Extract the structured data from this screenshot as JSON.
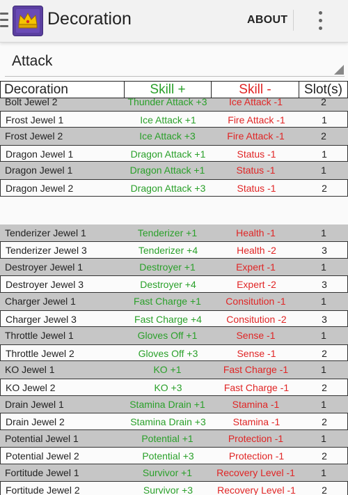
{
  "app": {
    "title": "Decoration",
    "about_label": "ABOUT"
  },
  "spinner": {
    "value": "Attack"
  },
  "table": {
    "headers": {
      "name": "Decoration",
      "plus": "Skill +",
      "minus": "Skill -",
      "slots": "Slot(s)"
    },
    "groups": [
      [
        {
          "name": "Bolt Jewel 2",
          "plus": "Thunder Attack +3",
          "minus": "Ice Attack -1",
          "slots": "2"
        },
        {
          "name": "Frost Jewel 1",
          "plus": "Ice Attack +1",
          "minus": "Fire Attack -1",
          "slots": "1"
        },
        {
          "name": "Frost Jewel 2",
          "plus": "Ice Attack +3",
          "minus": "Fire Attack -1",
          "slots": "2"
        },
        {
          "name": "Dragon Jewel 1",
          "plus": "Dragon Attack +1",
          "minus": "Status -1",
          "slots": "1"
        },
        {
          "name": "Dragon Jewel 1",
          "plus": "Dragon Attack +1",
          "minus": "Status -1",
          "slots": "1"
        },
        {
          "name": "Dragon Jewel 2",
          "plus": "Dragon Attack +3",
          "minus": "Status -1",
          "slots": "2"
        }
      ],
      [
        {
          "name": "Tenderizer Jewel 1",
          "plus": "Tenderizer +1",
          "minus": "Health -1",
          "slots": "1"
        },
        {
          "name": "Tenderizer Jewel 3",
          "plus": "Tenderizer +4",
          "minus": "Health -2",
          "slots": "3"
        },
        {
          "name": "Destroyer Jewel 1",
          "plus": "Destroyer +1",
          "minus": "Expert -1",
          "slots": "1"
        },
        {
          "name": "Destroyer Jewel 3",
          "plus": "Destroyer +4",
          "minus": "Expert -2",
          "slots": "3"
        },
        {
          "name": "Charger Jewel 1",
          "plus": "Fast Charge +1",
          "minus": "Consitution -1",
          "slots": "1"
        },
        {
          "name": "Charger Jewel 3",
          "plus": "Fast Charge +4",
          "minus": "Consitution -2",
          "slots": "3"
        },
        {
          "name": "Throttle Jewel 1",
          "plus": "Gloves Off +1",
          "minus": "Sense -1",
          "slots": "1"
        },
        {
          "name": "Throttle Jewel 2",
          "plus": "Gloves Off +3",
          "minus": "Sense -1",
          "slots": "2"
        },
        {
          "name": "KO Jewel 1",
          "plus": "KO +1",
          "minus": "Fast Charge -1",
          "slots": "1"
        },
        {
          "name": "KO Jewel 2",
          "plus": "KO +3",
          "minus": "Fast Charge -1",
          "slots": "2"
        },
        {
          "name": "Drain Jewel 1",
          "plus": "Stamina Drain +1",
          "minus": "Stamina -1",
          "slots": "1"
        },
        {
          "name": "Drain Jewel 2",
          "plus": "Stamina Drain +3",
          "minus": "Stamina -1",
          "slots": "2"
        },
        {
          "name": "Potential Jewel 1",
          "plus": "Potential +1",
          "minus": "Protection -1",
          "slots": "1"
        },
        {
          "name": "Potential Jewel 2",
          "plus": "Potential +3",
          "minus": "Protection -1",
          "slots": "2"
        },
        {
          "name": "Fortitude Jewel 1",
          "plus": "Survivor +1",
          "minus": "Recovery Level -1",
          "slots": "1"
        },
        {
          "name": "Fortitude Jewel 2",
          "plus": "Survivor +3",
          "minus": "Recovery Level -1",
          "slots": "2"
        }
      ]
    ]
  },
  "colors": {
    "plus": "#2aa02a",
    "minus": "#e02525",
    "row_gray": "#c6c6c6",
    "icon_bg": "#5b3fa0",
    "crown": "#f5c400"
  },
  "icons": [
    "navigation-drawer-icon",
    "crown-app-icon",
    "overflow-menu-icon",
    "spinner-dropdown-arrow-icon"
  ]
}
